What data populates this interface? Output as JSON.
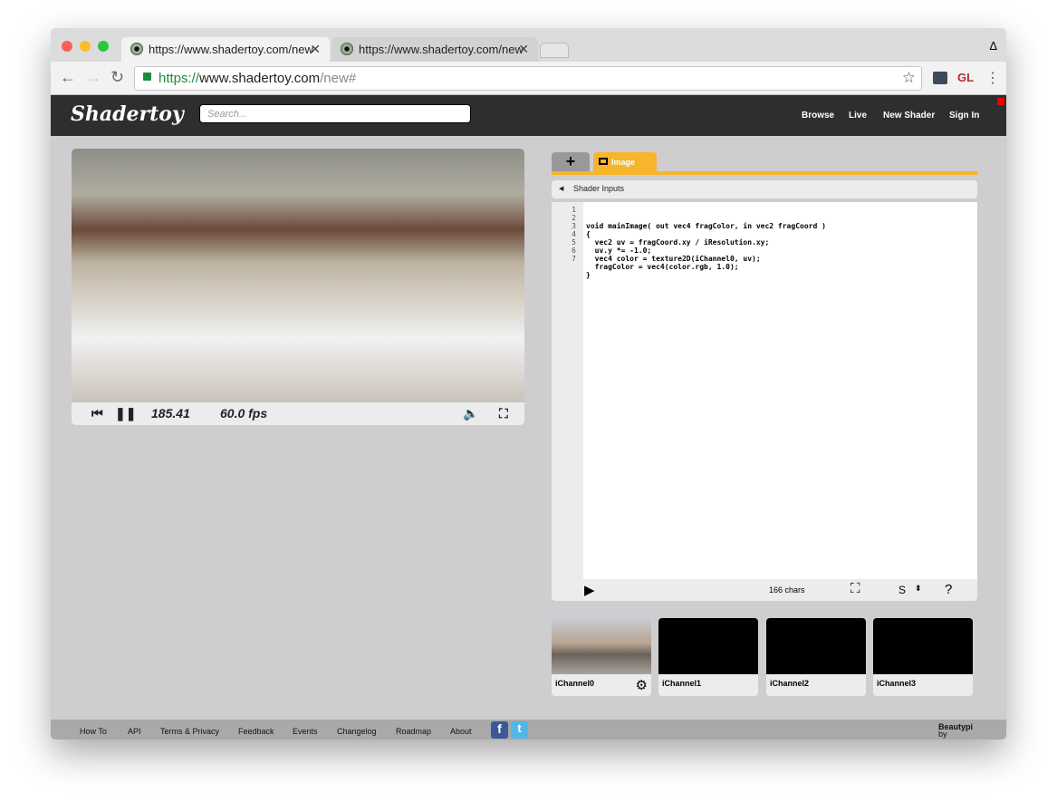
{
  "browser": {
    "tabs": [
      {
        "title": "https://www.shadertoy.com/new"
      },
      {
        "title": "https://www.shadertoy.com/new"
      }
    ],
    "url_scheme": "https://",
    "url_host": "www.shadertoy.com",
    "url_path": "/new#",
    "ext_label": "GL",
    "profile_label": "Δ"
  },
  "header": {
    "logo": "Shadertoy",
    "search_placeholder": "Search...",
    "menu": [
      "Browse",
      "Live",
      "New Shader",
      "Sign In"
    ]
  },
  "player": {
    "time": "185.41",
    "fps": "60.0 fps"
  },
  "editor": {
    "tab_image": "Image",
    "shader_inputs": "Shader Inputs",
    "line_numbers": [
      "1",
      "2",
      "3",
      "4",
      "5",
      "6",
      "7"
    ],
    "code": [
      "void mainImage( out vec4 fragColor, in vec2 fragCoord )",
      "{",
      "  vec2 uv = fragCoord.xy / iResolution.xy;",
      "  uv.y *= -1.0;",
      "  vec4 color = texture2D(iChannel0, uv);",
      "  fragColor = vec4(color.rgb, 1.0);",
      "}"
    ],
    "char_count": "166 chars",
    "font_size_label": "S",
    "help": "?"
  },
  "channels": [
    "iChannel0",
    "iChannel1",
    "iChannel2",
    "iChannel3"
  ],
  "footer": {
    "links": [
      "How To",
      "API",
      "Terms & Privacy",
      "Feedback",
      "Events",
      "Changelog",
      "Roadmap",
      "About"
    ],
    "credit_prefix": "by",
    "credit_name": "Beautypi"
  },
  "colors": {
    "accent": "#f7b52c",
    "header": "#2e2e2e"
  }
}
